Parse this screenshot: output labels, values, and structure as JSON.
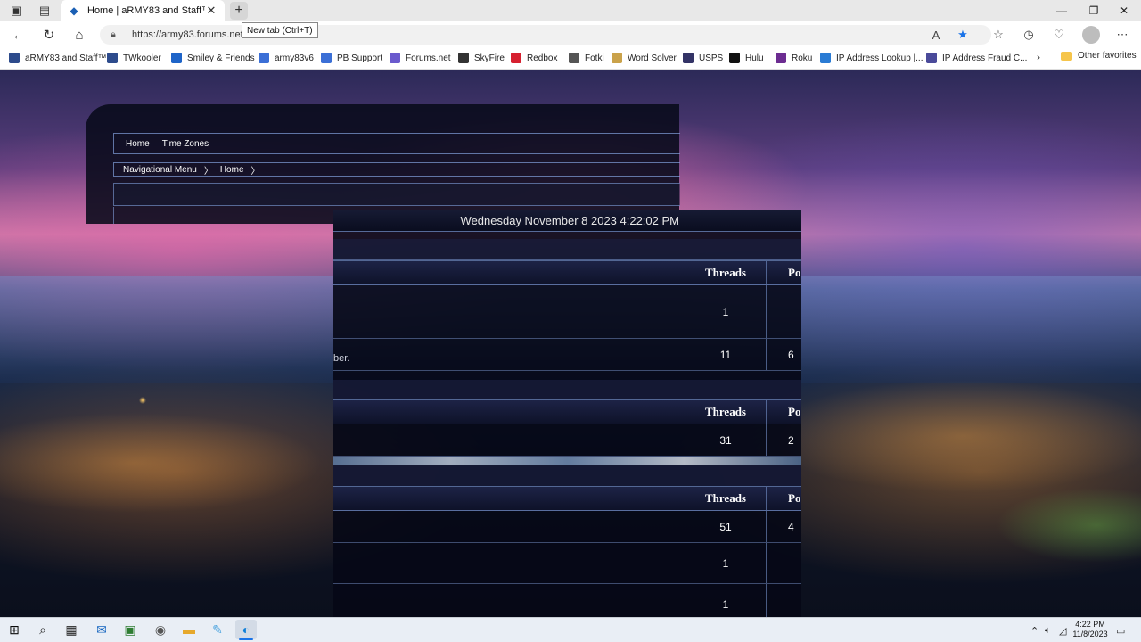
{
  "browser": {
    "tab_title": "Home | aRMY83 and Staff™",
    "url": "https://army83.forums.net",
    "tooltip": "New tab (Ctrl+T)",
    "bookmarks": [
      {
        "label": "aRMY83 and Staff™",
        "color": "#2d4b8c"
      },
      {
        "label": "TWkooler",
        "color": "#2d4b8c"
      },
      {
        "label": "Smiley & Friends",
        "color": "#1e64c8"
      },
      {
        "label": "army83v6",
        "color": "#3b6fd6"
      },
      {
        "label": "PB Support",
        "color": "#3b6fd6"
      },
      {
        "label": "Forums.net",
        "color": "#6a5acd"
      },
      {
        "label": "SkyFire",
        "color": "#333333"
      },
      {
        "label": "Redbox",
        "color": "#d6202f"
      },
      {
        "label": "Fotki",
        "color": "#555555"
      },
      {
        "label": "Word Solver",
        "color": "#caa24a"
      },
      {
        "label": "USPS",
        "color": "#333366"
      },
      {
        "label": "Hulu",
        "color": "#111111"
      },
      {
        "label": "Roku",
        "color": "#6c2c91"
      },
      {
        "label": "IP Address Lookup |...",
        "color": "#2a7bd4"
      },
      {
        "label": "IP Address Fraud C...",
        "color": "#4a4a9a"
      }
    ],
    "other_favorites": "Other favorites"
  },
  "forum": {
    "nav_links": [
      "Home",
      "Time Zones"
    ],
    "breadcrumb": [
      "Navigational Menu",
      "Home"
    ],
    "datetime": "Wednesday November 8 2023 4:22:02 PM",
    "col_threads": "Threads",
    "col_posts": "Po",
    "sections": [
      {
        "rows": [
          {
            "desc": "",
            "threads": "1",
            "posts": ""
          },
          {
            "desc": "ber.",
            "threads": "11",
            "posts": "6"
          }
        ]
      },
      {
        "rows": [
          {
            "desc": "",
            "threads": "31",
            "posts": "2"
          }
        ]
      },
      {
        "rows": [
          {
            "desc": "",
            "threads": "51",
            "posts": "4"
          },
          {
            "desc": "",
            "threads": "1",
            "posts": ""
          },
          {
            "desc": "",
            "threads": "1",
            "posts": ""
          }
        ]
      }
    ]
  },
  "taskbar": {
    "time": "4:22 PM",
    "date": "11/8/2023"
  }
}
